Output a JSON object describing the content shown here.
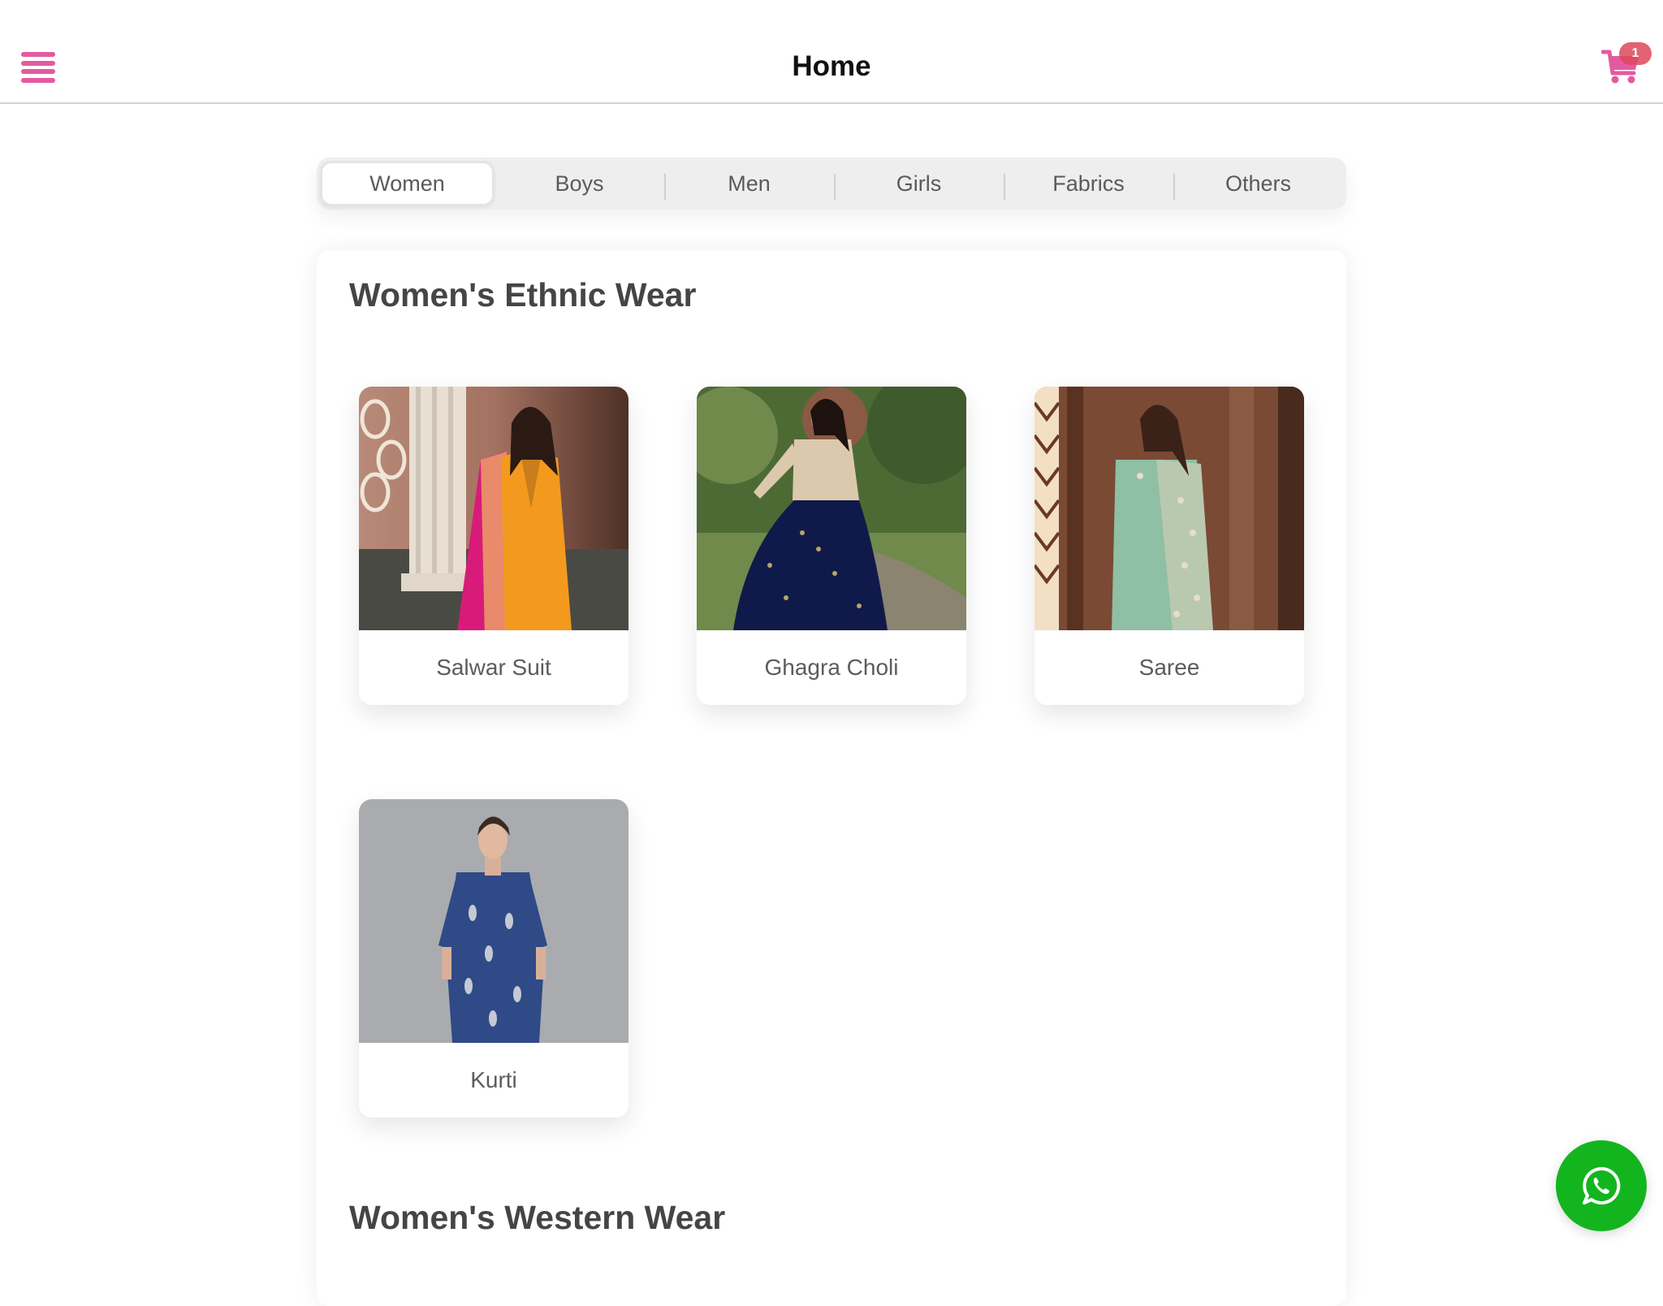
{
  "header": {
    "title": "Home",
    "menu_icon": "hamburger-menu-icon",
    "cart_icon": "shopping-cart-icon",
    "cart_count": "1"
  },
  "colors": {
    "accent_pink": "#e45aa0",
    "badge_red": "#de485a",
    "whatsapp_green": "#13b51f",
    "heading_text": "#454545",
    "segment_bg": "#eeeeee"
  },
  "category_tabs": {
    "selected": "Women",
    "items": [
      {
        "label": "Women",
        "active": true
      },
      {
        "label": "Boys",
        "active": false
      },
      {
        "label": "Men",
        "active": false
      },
      {
        "label": "Girls",
        "active": false
      },
      {
        "label": "Fabrics",
        "active": false
      },
      {
        "label": "Others",
        "active": false
      }
    ]
  },
  "sections": [
    {
      "title": "Women's Ethnic Wear",
      "products": [
        {
          "name": "Salwar Suit",
          "image": "woman in orange salwar suit with pink dupatta"
        },
        {
          "name": "Ghagra Choli",
          "image": "woman in navy blue ghagra with beige top"
        },
        {
          "name": "Saree",
          "image": "woman in mint green embroidered saree"
        },
        {
          "name": "Kurti",
          "image": "woman in blue printed kurti"
        }
      ]
    },
    {
      "title": "Women's Western Wear",
      "products": []
    }
  ],
  "floating_action": {
    "icon": "whatsapp-icon"
  }
}
